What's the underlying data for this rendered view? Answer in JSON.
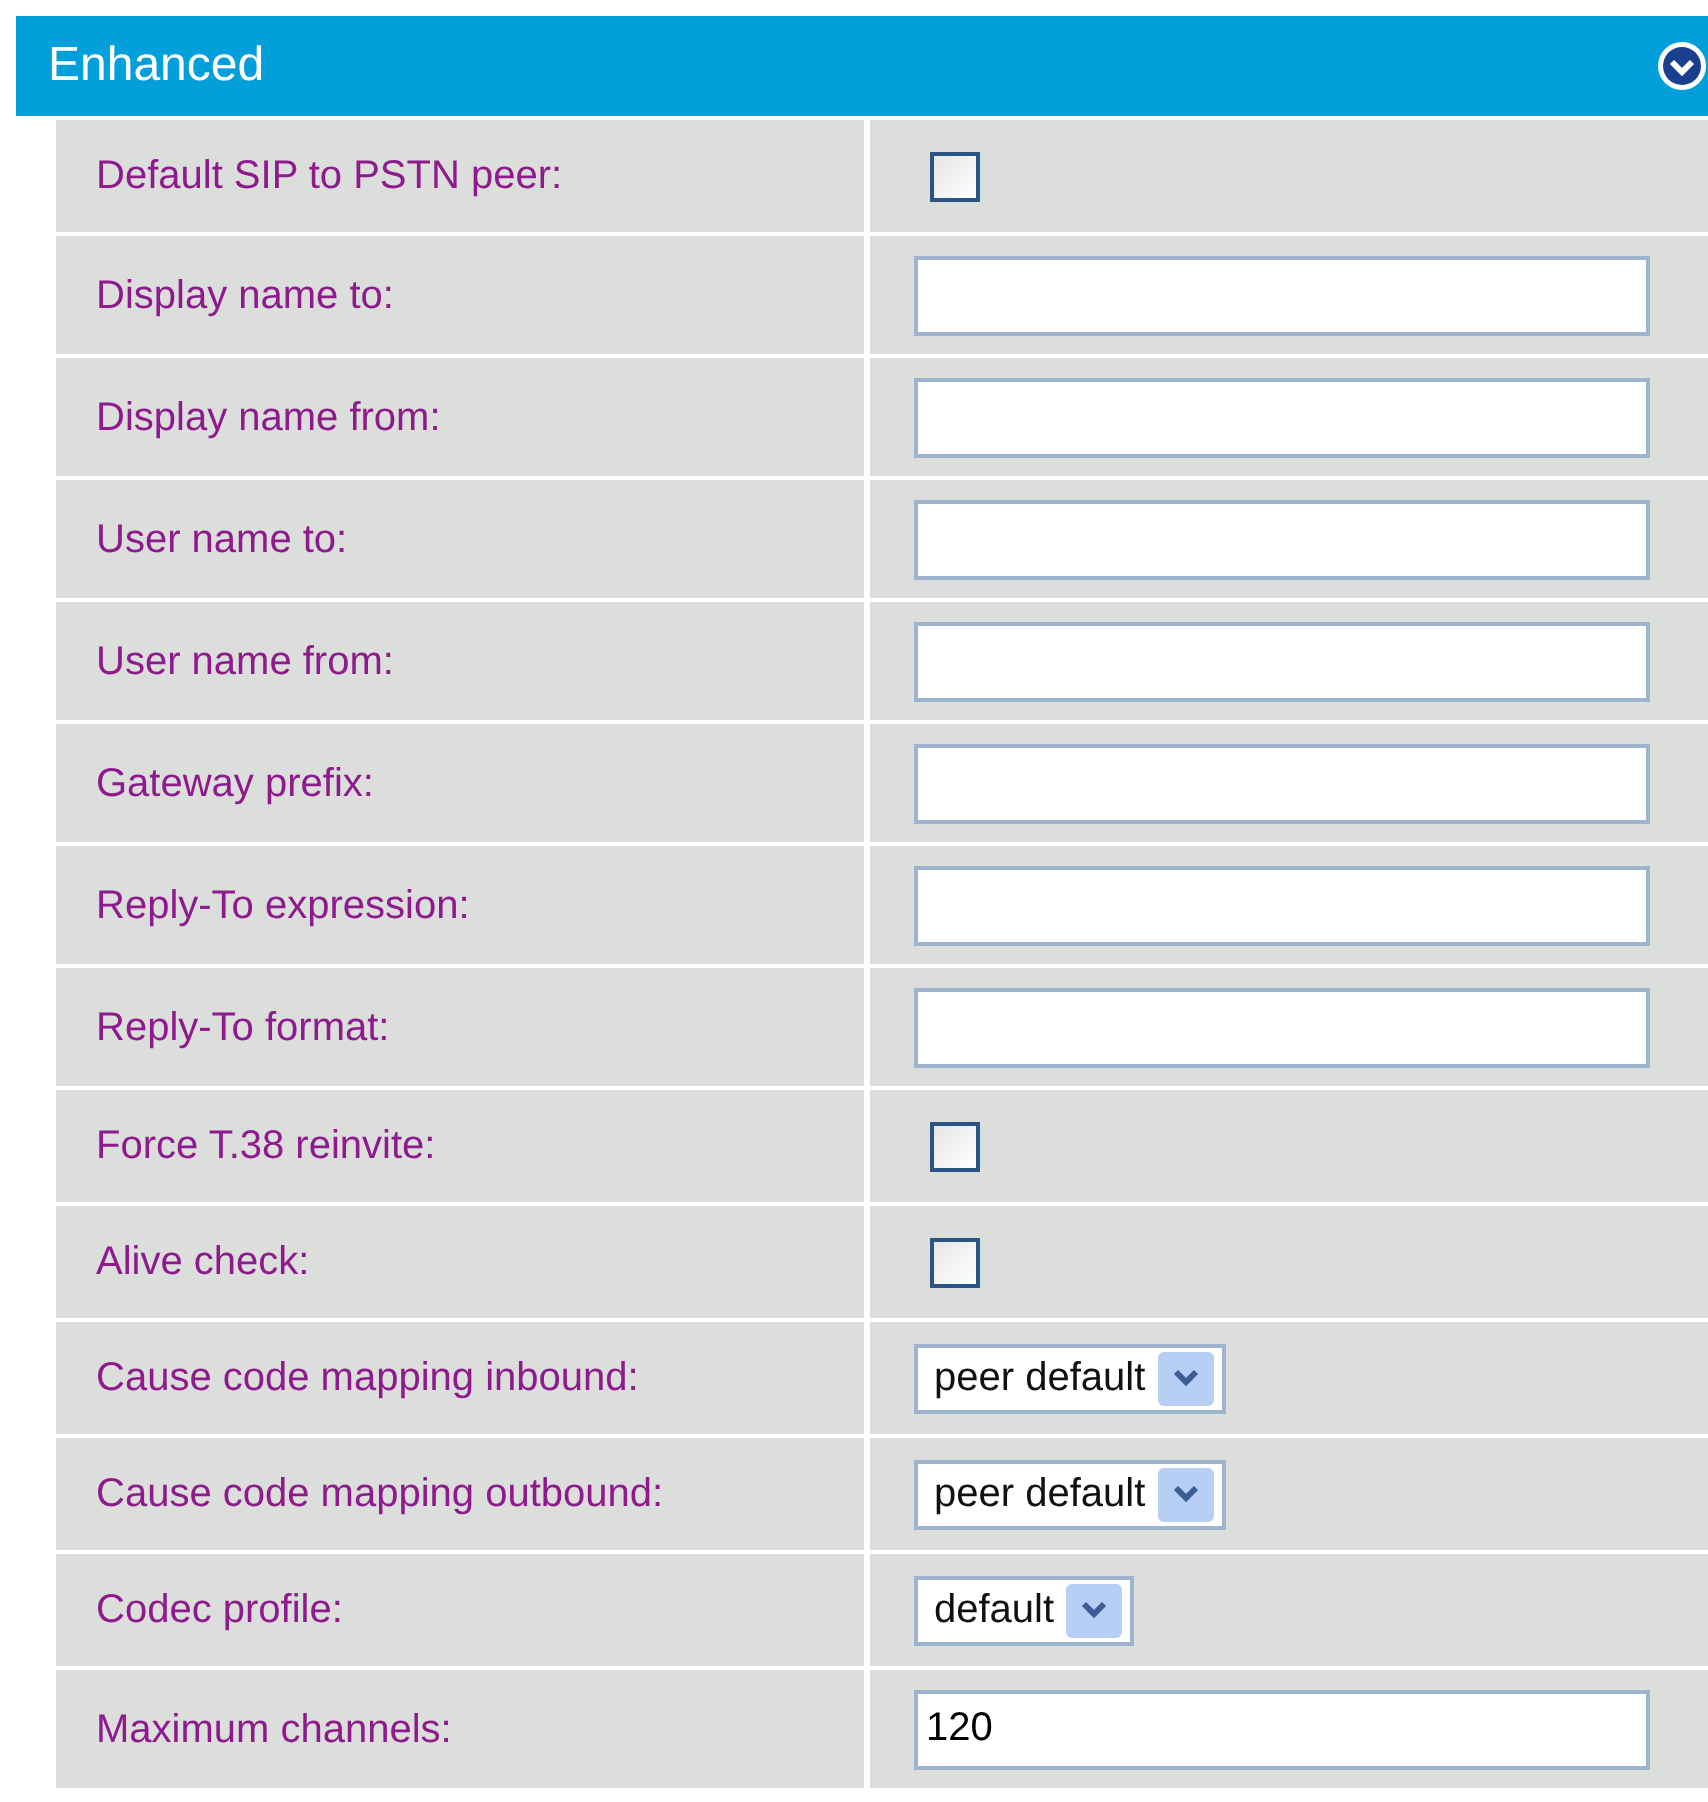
{
  "section": {
    "title": "Enhanced",
    "expanded": true
  },
  "fields": [
    {
      "label": "Default SIP to PSTN peer:",
      "kind": "checkbox",
      "checked": false
    },
    {
      "label": "Display name to:",
      "kind": "text"
    },
    {
      "label": "Display name from:",
      "kind": "text"
    },
    {
      "label": "User name to:",
      "kind": "text"
    },
    {
      "label": "User name from:",
      "kind": "text"
    },
    {
      "label": "Gateway prefix:",
      "kind": "text"
    },
    {
      "label": "Reply-To expression:",
      "kind": "text"
    },
    {
      "label": "Reply-To format:",
      "kind": "text"
    },
    {
      "label": "Force T.38 reinvite:",
      "kind": "checkbox",
      "checked": false
    },
    {
      "label": "Alive check:",
      "kind": "checkbox",
      "checked": false
    },
    {
      "label": "Cause code mapping inbound:",
      "kind": "select",
      "value": "peer default"
    },
    {
      "label": "Cause code mapping outbound:",
      "kind": "select",
      "value": "peer default"
    },
    {
      "label": "Codec profile:",
      "kind": "select",
      "value": "default"
    },
    {
      "label": "Maximum channels:",
      "kind": "text",
      "value": "120"
    }
  ]
}
